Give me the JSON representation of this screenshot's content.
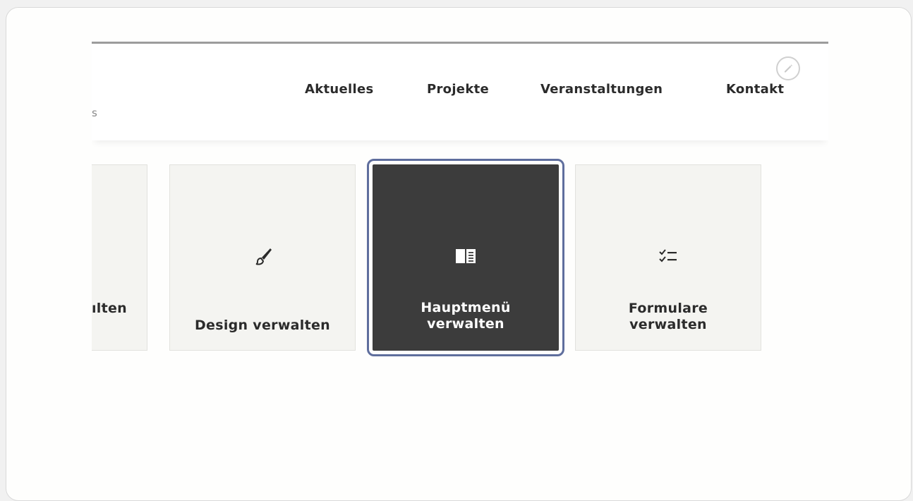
{
  "header": {
    "logo_fragment": "s",
    "nav": [
      "Aktuelles",
      "Projekte",
      "Veranstaltungen",
      "Kontakt"
    ],
    "edit_icon": "pencil-icon"
  },
  "tiles": [
    {
      "label": "ılten",
      "icon": "none"
    },
    {
      "label": "Design verwalten",
      "icon": "paintbrush-icon"
    },
    {
      "label_line1": "Hauptmenü",
      "label_line2": "verwalten",
      "icon": "book-icon",
      "selected": true
    },
    {
      "label_line1": "Formulare",
      "label_line2": "verwalten",
      "icon": "checklist-icon"
    }
  ],
  "colors": {
    "active_tile_bg": "#3c3c3c",
    "focus_ring": "#5f6e9d",
    "tile_bg": "#f4f4f1"
  }
}
